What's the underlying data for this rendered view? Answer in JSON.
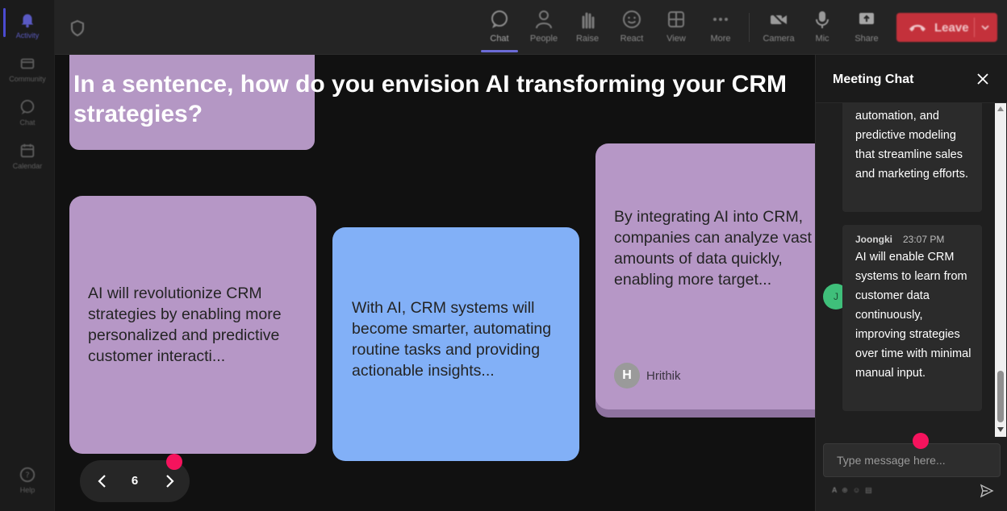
{
  "rail": {
    "items": [
      {
        "label": "Activity",
        "icon": "bell-icon",
        "active": true
      },
      {
        "label": "Community",
        "icon": "community-icon"
      },
      {
        "label": "Chat",
        "icon": "chat-icon"
      },
      {
        "label": "Calendar",
        "icon": "calendar-icon"
      },
      {
        "label": "Help",
        "icon": "help-icon"
      }
    ]
  },
  "toolbar": {
    "chat": "Chat",
    "people": "People",
    "raise": "Raise",
    "react": "React",
    "view": "View",
    "more": "More",
    "camera": "Camera",
    "mic": "Mic",
    "share": "Share",
    "leave": "Leave"
  },
  "stage": {
    "question": "In a sentence, how do you envision AI transforming your CRM strategies?",
    "cards": [
      {
        "text": "AI will revolutionize CRM strategies by enabling more personalized and predictive customer interacti...",
        "color": "#b697c6"
      },
      {
        "text": "With AI, CRM systems will become smarter, automating routine tasks and providing actionable insights...",
        "color": "#82b0f7"
      },
      {
        "text": "By integrating AI into CRM, companies can analyze vast amounts of data quickly, enabling more target...",
        "color": "#b697c6",
        "author_initial": "H",
        "author": "Hrithik"
      }
    ],
    "pager": {
      "page": "6"
    }
  },
  "chat": {
    "title": "Meeting Chat",
    "messages": [
      {
        "text": "automation, and predictive modeling that streamline sales and marketing efforts."
      },
      {
        "author": "Joongki",
        "initial": "J",
        "time": "23:07 PM",
        "text": "AI will enable CRM systems to learn from customer data continuously, improving strategies over time with minimal manual input."
      }
    ],
    "placeholder": "Type message here..."
  },
  "colors": {
    "accent": "#6b6bd6",
    "leave": "#c4313b",
    "marker": "#f5135d"
  }
}
